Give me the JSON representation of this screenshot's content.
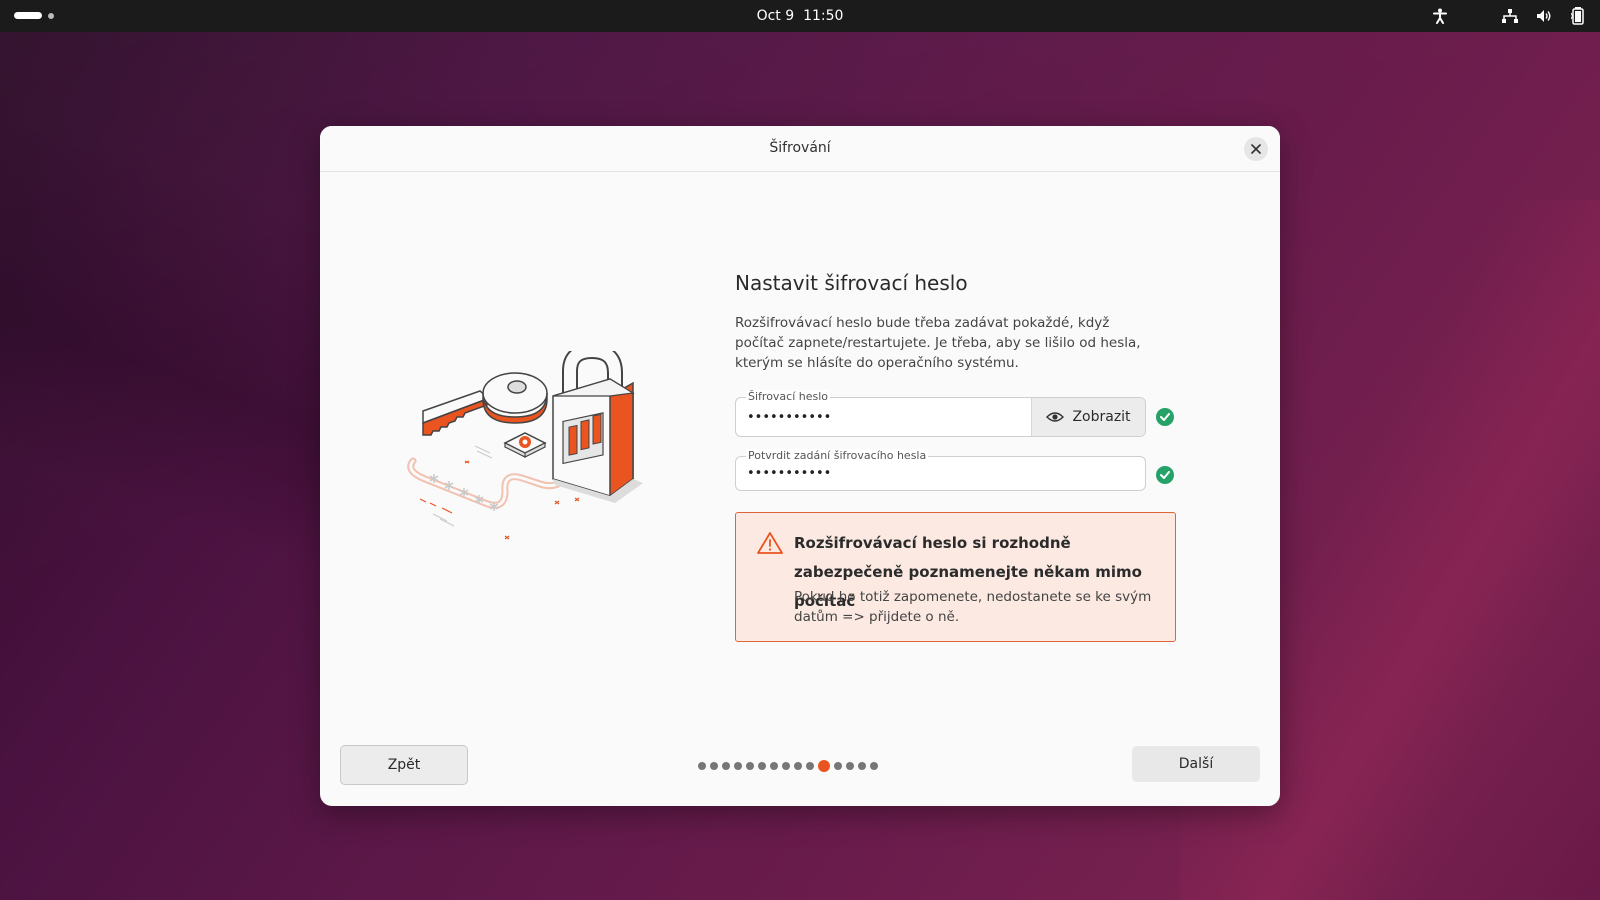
{
  "topbar": {
    "date": "Oct 9",
    "time": "11:50",
    "icons": [
      "accessibility-icon",
      "network-icon",
      "volume-icon",
      "battery-icon"
    ]
  },
  "dialog": {
    "title": "Šifrování",
    "heading": "Nastavit šifrovací heslo",
    "description": "Rozšifrovávací heslo bude třeba zadávat pokaždé, když počítač zapnete/restartujete. Je třeba, aby se lišilo od hesla, kterým se hlásíte do operačního systému.",
    "password_field": {
      "label": "Šifrovací heslo",
      "value": "•••••••••••",
      "show_label": "Zobrazit",
      "valid": true
    },
    "confirm_field": {
      "label": "Potvrdit zadání šifrovacího hesla",
      "value": "•••••••••••",
      "valid": true
    },
    "warning": {
      "title": "Rozšifrovávací heslo si rozhodně zabezpečeně poznamenejte někam mimo počítač",
      "text": "Pokud ho totiž zapomenete, nedostanete se ke svým datům => přijdete o ně."
    },
    "back_label": "Zpět",
    "next_label": "Další",
    "pager": {
      "total": 15,
      "current": 11
    }
  },
  "colors": {
    "accent": "#e95420",
    "success": "#26a269",
    "warning_bg": "#fbe9e2",
    "warning_border": "#e0643a"
  }
}
